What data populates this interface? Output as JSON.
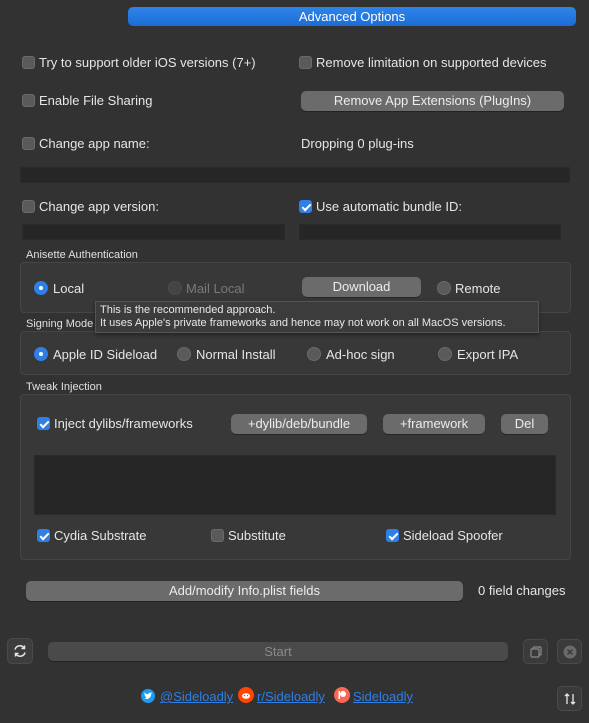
{
  "header": {
    "advanced_options": "Advanced Options"
  },
  "options": {
    "older_ios": "Try to support older iOS versions (7+)",
    "remove_limitation": "Remove limitation on supported devices",
    "file_sharing": "Enable File Sharing",
    "remove_extensions": "Remove App Extensions (PlugIns)",
    "change_name": "Change app name:",
    "dropping": "Dropping 0 plug-ins",
    "change_version": "Change app version:",
    "auto_bundle": "Use automatic bundle ID:",
    "auto_bundle_checked": true
  },
  "anisette": {
    "title": "Anisette Authentication",
    "local": "Local",
    "mail_local": "Mail Local",
    "download": "Download",
    "remote": "Remote",
    "selected": "Local"
  },
  "tooltip": {
    "line1": "This is the recommended approach.",
    "line2": "It uses Apple's private frameworks and hence may not work on all MacOS versions."
  },
  "signing": {
    "title": "Signing Mode",
    "apple_id": "Apple ID Sideload",
    "normal": "Normal Install",
    "adhoc": "Ad-hoc sign",
    "export": "Export IPA",
    "selected": "Apple ID Sideload"
  },
  "tweak": {
    "title": "Tweak Injection",
    "inject": "Inject dylibs/frameworks",
    "inject_checked": true,
    "add_dylib": "+dylib/deb/bundle",
    "add_framework": "+framework",
    "del": "Del",
    "cydia": "Cydia Substrate",
    "cydia_checked": true,
    "substitute": "Substitute",
    "substitute_checked": false,
    "spoofer": "Sideload Spoofer",
    "spoofer_checked": true
  },
  "plist": {
    "button": "Add/modify Info.plist fields",
    "changes": "0 field changes"
  },
  "footer": {
    "start": "Start",
    "twitter": "@Sideloadly",
    "reddit": "r/Sideloadly",
    "patreon": "Sideloadly"
  },
  "colors": {
    "accent": "#2f7fe4",
    "background": "#323232",
    "twitter": "#1d9bf0",
    "reddit": "#ff4500",
    "patreon": "#f96854"
  },
  "icons": [
    "refresh-icon",
    "copy-icon",
    "close-icon",
    "sort-icon",
    "twitter-icon",
    "reddit-icon",
    "patreon-icon"
  ]
}
